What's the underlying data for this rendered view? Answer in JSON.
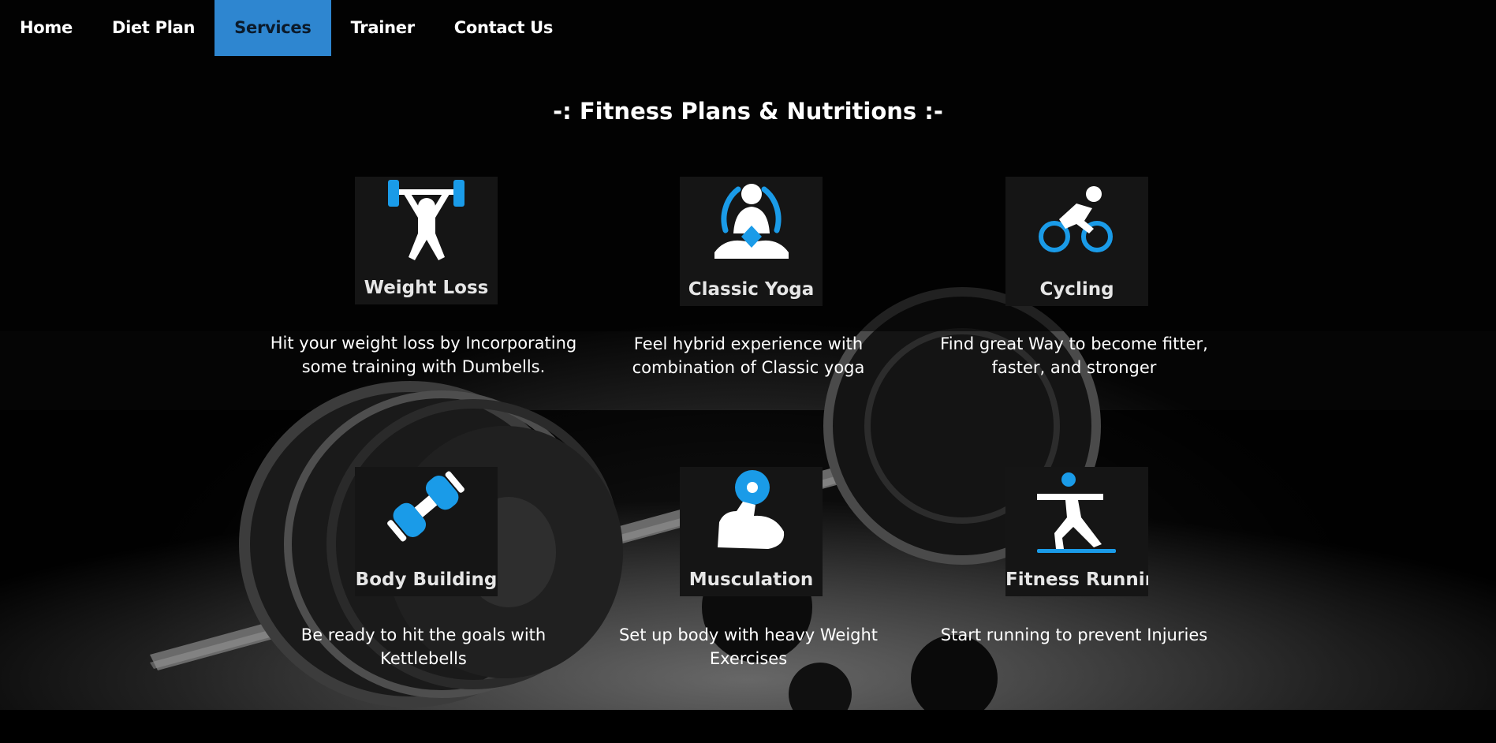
{
  "nav": {
    "items": [
      {
        "label": "Home",
        "active": false
      },
      {
        "label": "Diet Plan",
        "active": false
      },
      {
        "label": "Services",
        "active": true
      },
      {
        "label": "Trainer",
        "active": false
      },
      {
        "label": "Contact Us",
        "active": false
      }
    ]
  },
  "section": {
    "title": "-: Fitness Plans & Nutritions :-"
  },
  "services": [
    {
      "icon": "weightlifter-icon",
      "label": "Weight Loss",
      "description": "Hit your weight loss by Incorporating some training with Dumbells."
    },
    {
      "icon": "yoga-icon",
      "label": "Classic Yoga",
      "description": "Feel hybrid experience with combination of Classic yoga"
    },
    {
      "icon": "cyclist-icon",
      "label": "Cycling",
      "description": "Find great Way to become fitter, faster, and stronger"
    },
    {
      "icon": "dumbbell-icon",
      "label": "Body Building",
      "description": "Be ready to hit the goals with Kettlebells"
    },
    {
      "icon": "flexed-arm-icon",
      "label": "Musculation",
      "description": "Set up body with heavy Weight Exercises"
    },
    {
      "icon": "runner-icon",
      "label": "Fitness Running",
      "description": "Start running to prevent Injuries"
    }
  ],
  "colors": {
    "accent": "#2e86d0",
    "icon_blue": "#1a9be8",
    "background": "#000000",
    "text": "#ffffff"
  }
}
